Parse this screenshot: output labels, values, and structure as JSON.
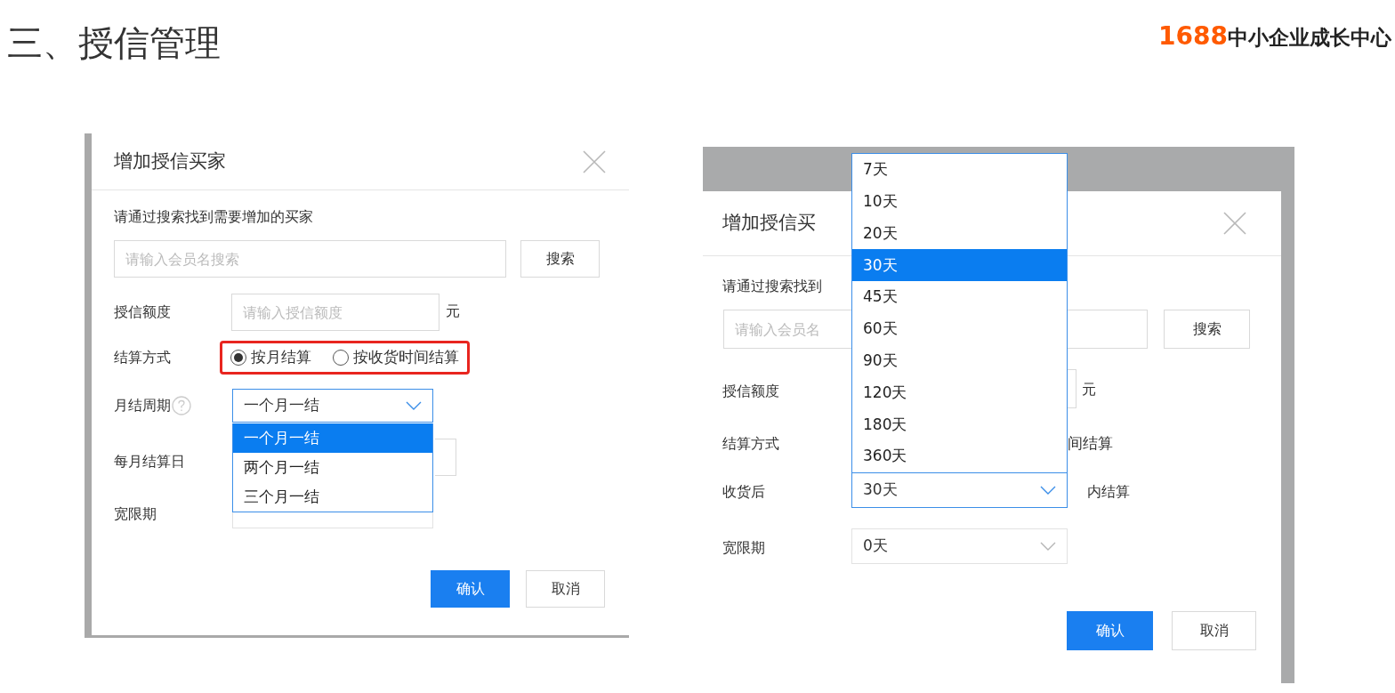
{
  "slide": {
    "title": "三、授信管理",
    "logo": {
      "number": "1688",
      "text": "中小企业成长中心"
    }
  },
  "dialog_left": {
    "title": "增加授信买家",
    "instruction": "请通过搜索找到需要增加的买家",
    "search": {
      "placeholder": "请输入会员名搜索",
      "button": "搜索"
    },
    "credit": {
      "label": "授信额度",
      "placeholder": "请输入授信额度",
      "unit": "元"
    },
    "settlement": {
      "label": "结算方式",
      "highlighted": true,
      "options": [
        {
          "label": "按月结算",
          "selected": true
        },
        {
          "label": "按收货时间结算",
          "selected": false
        }
      ]
    },
    "cycle": {
      "label": "月结周期",
      "value": "一个月一结",
      "options": [
        {
          "label": "一个月一结",
          "selected": true
        },
        {
          "label": "两个月一结",
          "selected": false
        },
        {
          "label": "三个月一结",
          "selected": false
        }
      ]
    },
    "day_label": "每月结算日",
    "grace_label": "宽限期",
    "confirm": "确认",
    "cancel": "取消"
  },
  "dialog_right": {
    "title": "增加授信买",
    "instruction": "请通过搜索找到",
    "search": {
      "placeholder": "请输入会员名",
      "button": "搜索"
    },
    "credit": {
      "label": "授信额度",
      "unit": "元"
    },
    "settlement": {
      "label": "结算方式",
      "option_tail": "间结算"
    },
    "after_receipt": {
      "label": "收货后",
      "value": "30天",
      "suffix": "内结算",
      "options": [
        {
          "label": "7天",
          "selected": false
        },
        {
          "label": "10天",
          "selected": false
        },
        {
          "label": "20天",
          "selected": false
        },
        {
          "label": "30天",
          "selected": true
        },
        {
          "label": "45天",
          "selected": false
        },
        {
          "label": "60天",
          "selected": false
        },
        {
          "label": "90天",
          "selected": false
        },
        {
          "label": "120天",
          "selected": false
        },
        {
          "label": "180天",
          "selected": false
        },
        {
          "label": "360天",
          "selected": false
        }
      ]
    },
    "grace": {
      "label": "宽限期",
      "value": "0天"
    },
    "confirm": "确认",
    "cancel": "取消"
  }
}
